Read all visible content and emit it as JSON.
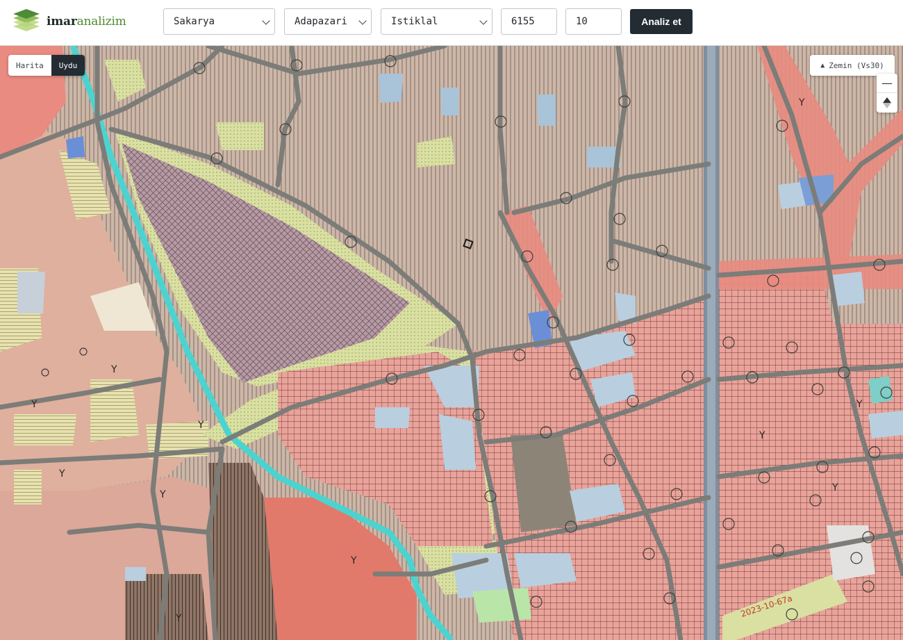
{
  "app": {
    "logo_text_bold": "imar",
    "logo_text_light": "analizim"
  },
  "filters": {
    "province": "Sakarya",
    "district": "Adapazari",
    "neighborhood": "Istiklal",
    "block": "6155",
    "parcel": "10",
    "analyze_label": "Analiz et"
  },
  "map": {
    "view_options": [
      "Harita",
      "Uydu"
    ],
    "active_view": "Uydu",
    "layer_label": "Zemin (Vs30)",
    "layer_icon": "layers-icon",
    "zoom_out_icon": "minus-icon",
    "reset_north_icon": "compass-icon",
    "annotation_text": "2023-10-67a",
    "zone_label_letter": "Y",
    "colors": {
      "residential": "#e9a39a",
      "agricultural": "#cdb7a9",
      "green_area": "#d9e0a1",
      "canal": "#4dd3cf",
      "road": "#7c7c78",
      "industrial": "#b89aa5",
      "public": "#b9cfdf",
      "red_zone": "#dd6b5e"
    }
  }
}
